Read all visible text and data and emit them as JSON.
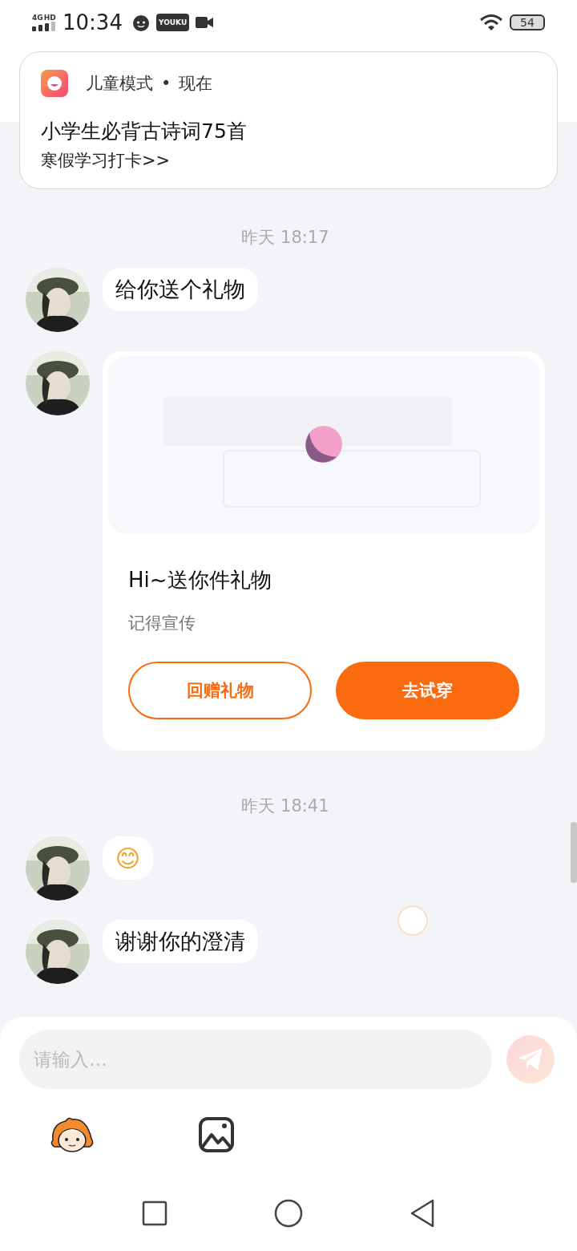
{
  "status_bar": {
    "network": "4G",
    "network_extra": "HD",
    "time": "10:34",
    "app_badge": "YOUKU",
    "battery": "54"
  },
  "notification": {
    "app": "儿童模式",
    "separator": "•",
    "time": "现在",
    "title": "小学生必背古诗词75首",
    "body": "寒假学习打卡>>"
  },
  "messages": [
    {
      "kind": "time",
      "text": "昨天 18:17"
    },
    {
      "kind": "text",
      "text": "给你送个礼物"
    },
    {
      "kind": "gift",
      "title": "Hi~送你件礼物",
      "subtitle": "记得宣传",
      "buttons": [
        {
          "label": "回赠礼物",
          "kind": "outline"
        },
        {
          "label": "去试穿",
          "kind": "filled"
        }
      ]
    },
    {
      "kind": "time",
      "text": "昨天 18:41"
    },
    {
      "kind": "emoji",
      "text": "😊"
    },
    {
      "kind": "text",
      "text": "谢谢你的澄清"
    }
  ],
  "composer": {
    "placeholder": "请输入…",
    "send_enabled": false
  }
}
